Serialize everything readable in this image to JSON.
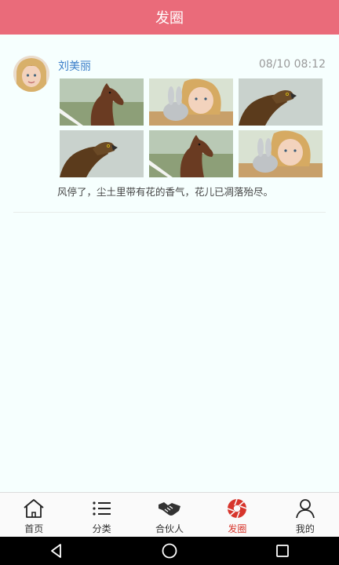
{
  "header": {
    "title": "发圈"
  },
  "post": {
    "author": "刘美丽",
    "time": "08/10 08:12",
    "text": "风停了，尘土里带有花的香气，花儿已凋落殆尽。",
    "images": [
      "horse-photo",
      "child-with-bunny-photo",
      "eagle-photo",
      "eagle-photo",
      "horse-photo",
      "child-with-bunny-photo"
    ]
  },
  "tabs": [
    {
      "label": "首页",
      "icon": "home-icon",
      "active": false
    },
    {
      "label": "分类",
      "icon": "list-icon",
      "active": false
    },
    {
      "label": "合伙人",
      "icon": "handshake-icon",
      "active": false
    },
    {
      "label": "发圈",
      "icon": "camera-aperture-icon",
      "active": true
    },
    {
      "label": "我的",
      "icon": "user-icon",
      "active": false
    }
  ],
  "colors": {
    "header": "#ea6b7a",
    "active_tab": "#d7352c",
    "username": "#3a7ec9"
  },
  "system_nav": [
    "back-icon",
    "home-circle-icon",
    "recents-icon"
  ]
}
